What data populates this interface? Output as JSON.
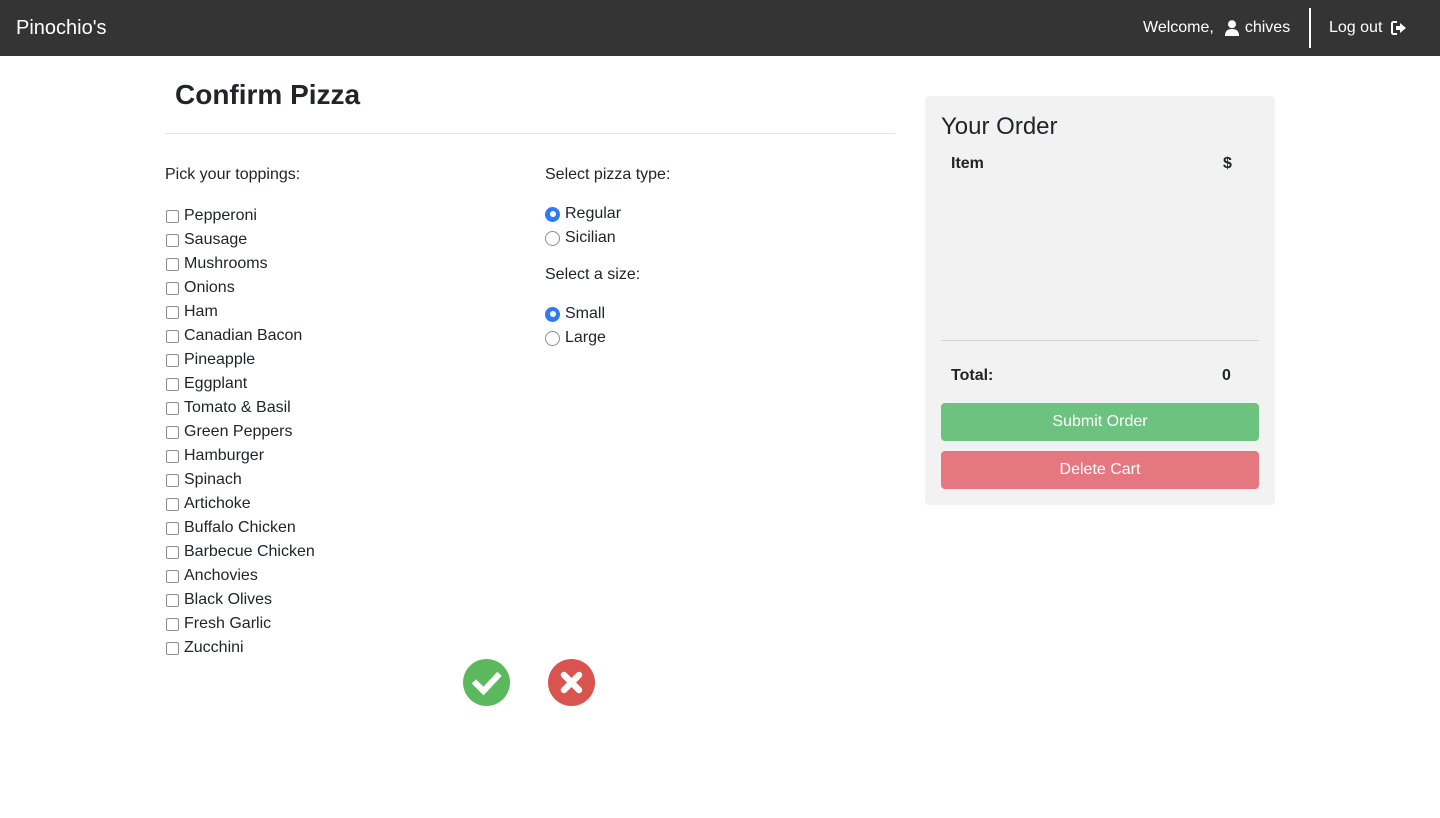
{
  "navbar": {
    "brand": "Pinochio's",
    "welcome": "Welcome,",
    "username": "chives",
    "logout": "Log out",
    "icons": [
      "user-icon",
      "logout-icon"
    ]
  },
  "main": {
    "title": "Confirm Pizza",
    "toppings_label": "Pick your toppings:",
    "toppings": [
      {
        "label": "Pepperoni",
        "checked": false
      },
      {
        "label": "Sausage",
        "checked": false
      },
      {
        "label": "Mushrooms",
        "checked": false
      },
      {
        "label": "Onions",
        "checked": false
      },
      {
        "label": "Ham",
        "checked": false
      },
      {
        "label": "Canadian Bacon",
        "checked": false
      },
      {
        "label": "Pineapple",
        "checked": false
      },
      {
        "label": "Eggplant",
        "checked": false
      },
      {
        "label": "Tomato & Basil",
        "checked": false
      },
      {
        "label": "Green Peppers",
        "checked": false
      },
      {
        "label": "Hamburger",
        "checked": false
      },
      {
        "label": "Spinach",
        "checked": false
      },
      {
        "label": "Artichoke",
        "checked": false
      },
      {
        "label": "Buffalo Chicken",
        "checked": false
      },
      {
        "label": "Barbecue Chicken",
        "checked": false
      },
      {
        "label": "Anchovies",
        "checked": false
      },
      {
        "label": "Black Olives",
        "checked": false
      },
      {
        "label": "Fresh Garlic",
        "checked": false
      },
      {
        "label": "Zucchini",
        "checked": false
      }
    ],
    "type_label": "Select pizza type:",
    "types": [
      {
        "label": "Regular",
        "checked": true
      },
      {
        "label": "Sicilian",
        "checked": false
      }
    ],
    "size_label": "Select a size:",
    "sizes": [
      {
        "label": "Small",
        "checked": true
      },
      {
        "label": "Large",
        "checked": false
      }
    ],
    "actions": {
      "confirm_icon": "check-icon",
      "cancel_icon": "close-icon",
      "confirm_color": "#5cb85c",
      "cancel_color": "#d9534f"
    }
  },
  "order": {
    "title": "Your Order",
    "col_item": "Item",
    "col_price": "$",
    "total_label": "Total:",
    "total_value": "0",
    "submit_label": "Submit Order",
    "delete_label": "Delete Cart",
    "submit_color": "#6cc37f",
    "delete_color": "#e57780"
  }
}
